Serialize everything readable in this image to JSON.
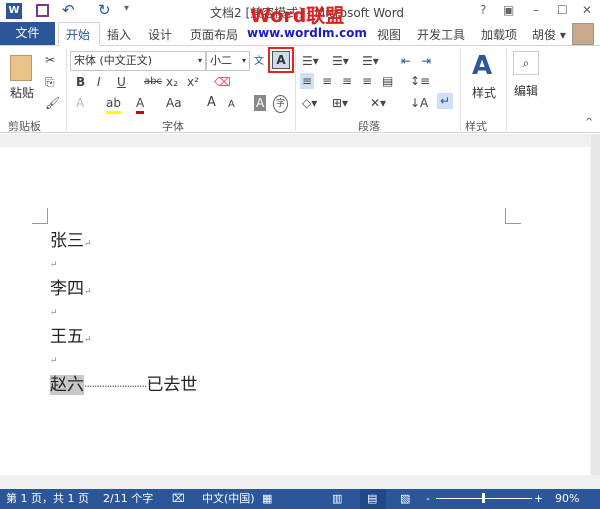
{
  "titlebar": {
    "title": "文档2 [兼容模式] - Microsoft Word",
    "watermark_logo": "Word联盟",
    "watermark_url": "www.wordlm.com",
    "help": "?",
    "ribbon_display": "▣",
    "minimize": "–",
    "maximize": "☐",
    "close": "✕"
  },
  "quick_access": {
    "word_icon": "W",
    "undo": "↶",
    "redo": "↻",
    "customize": "▾"
  },
  "tabs": {
    "file": "文件",
    "items": [
      "开始",
      "插入",
      "设计",
      "页面布局",
      "视图",
      "开发工具",
      "加载项"
    ],
    "user": "胡俊 ▾"
  },
  "ribbon": {
    "clipboard": {
      "label": "剪贴板",
      "paste": "粘贴"
    },
    "font": {
      "label": "字体",
      "font_name": "宋体 (中文正文)",
      "font_size": "小二",
      "phonetic": "文",
      "char_border": "A",
      "bold": "B",
      "italic": "I",
      "underline": "U",
      "strike": "abc",
      "subscript": "x₂",
      "superscript": "x²",
      "text_effect": "A",
      "highlight": "ab",
      "font_color": "A",
      "change_case": "Aa",
      "grow": "A",
      "shrink": "A",
      "shading": "A",
      "enclose": "字"
    },
    "paragraph": {
      "label": "段落"
    },
    "styles": {
      "label": "样式",
      "button": "样式"
    },
    "editing": {
      "button": "编辑"
    }
  },
  "document": {
    "lines": [
      "张三",
      "",
      "李四",
      "",
      "王五",
      ""
    ],
    "last_left": "赵六",
    "last_leader": "·························",
    "last_right": "已去世"
  },
  "status": {
    "page": "第 1 页，共 1 页",
    "words": "2/11 个字",
    "language": "中文(中国)",
    "zoom": "90%",
    "zoom_percent": 90
  },
  "colors": {
    "accent": "#2b579a",
    "highlight_box": "#e32323",
    "selection": "#c8c8c8"
  }
}
